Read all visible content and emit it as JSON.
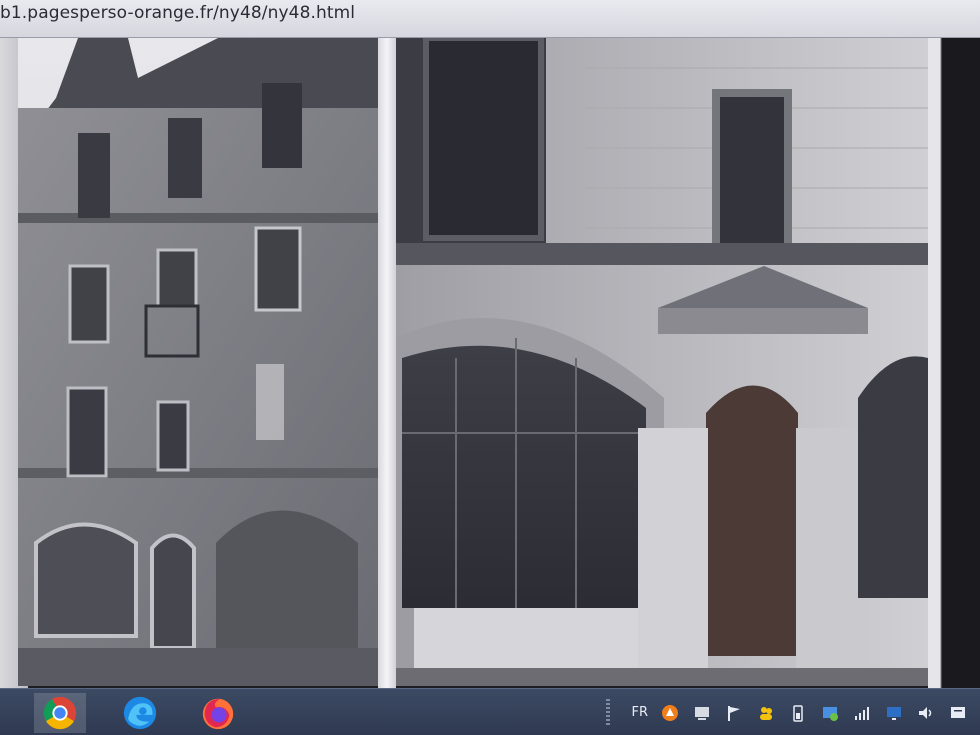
{
  "browser": {
    "url": "b1.pagesperso-orange.fr/ny48/ny48.html"
  },
  "photo": {
    "subject": "",
    "tone": "sepia-grey black-and-white"
  },
  "taskbar": {
    "apps": [
      {
        "name": "chrome-icon",
        "active": true
      },
      {
        "name": "edge-icon",
        "active": false
      },
      {
        "name": "firefox-icon",
        "active": false
      }
    ],
    "language": "FR",
    "tray_icons": [
      "avast-icon",
      "network-drive-icon",
      "flag-icon",
      "people-icon",
      "battery-icon",
      "update-icon",
      "signal-icon",
      "display-icon",
      "volume-icon",
      "notification-icon"
    ]
  },
  "colors": {
    "taskbar": "#2f3a52",
    "addressbar": "#e2e2ea"
  }
}
